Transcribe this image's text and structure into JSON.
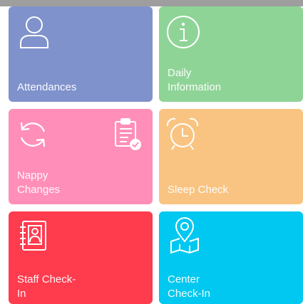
{
  "tiles": [
    {
      "label": "Attendances",
      "color": "#7f92cc",
      "icon": "user-icon"
    },
    {
      "label": "Daily\nInformation",
      "color": "#8fd497",
      "icon": "info-icon"
    },
    {
      "label": "Nappy\nChanges",
      "color": "#ff8fb8",
      "icon": "refresh-icon",
      "secondary_icon": "clipboard-check-icon"
    },
    {
      "label": "Sleep Check",
      "color": "#f9c482",
      "icon": "alarm-clock-icon"
    },
    {
      "label": "Staff Check-\nIn",
      "color": "#ff3b4e",
      "icon": "contact-book-icon"
    },
    {
      "label": "Center\nCheck-In",
      "color": "#00c8f0",
      "icon": "map-pin-icon"
    }
  ]
}
